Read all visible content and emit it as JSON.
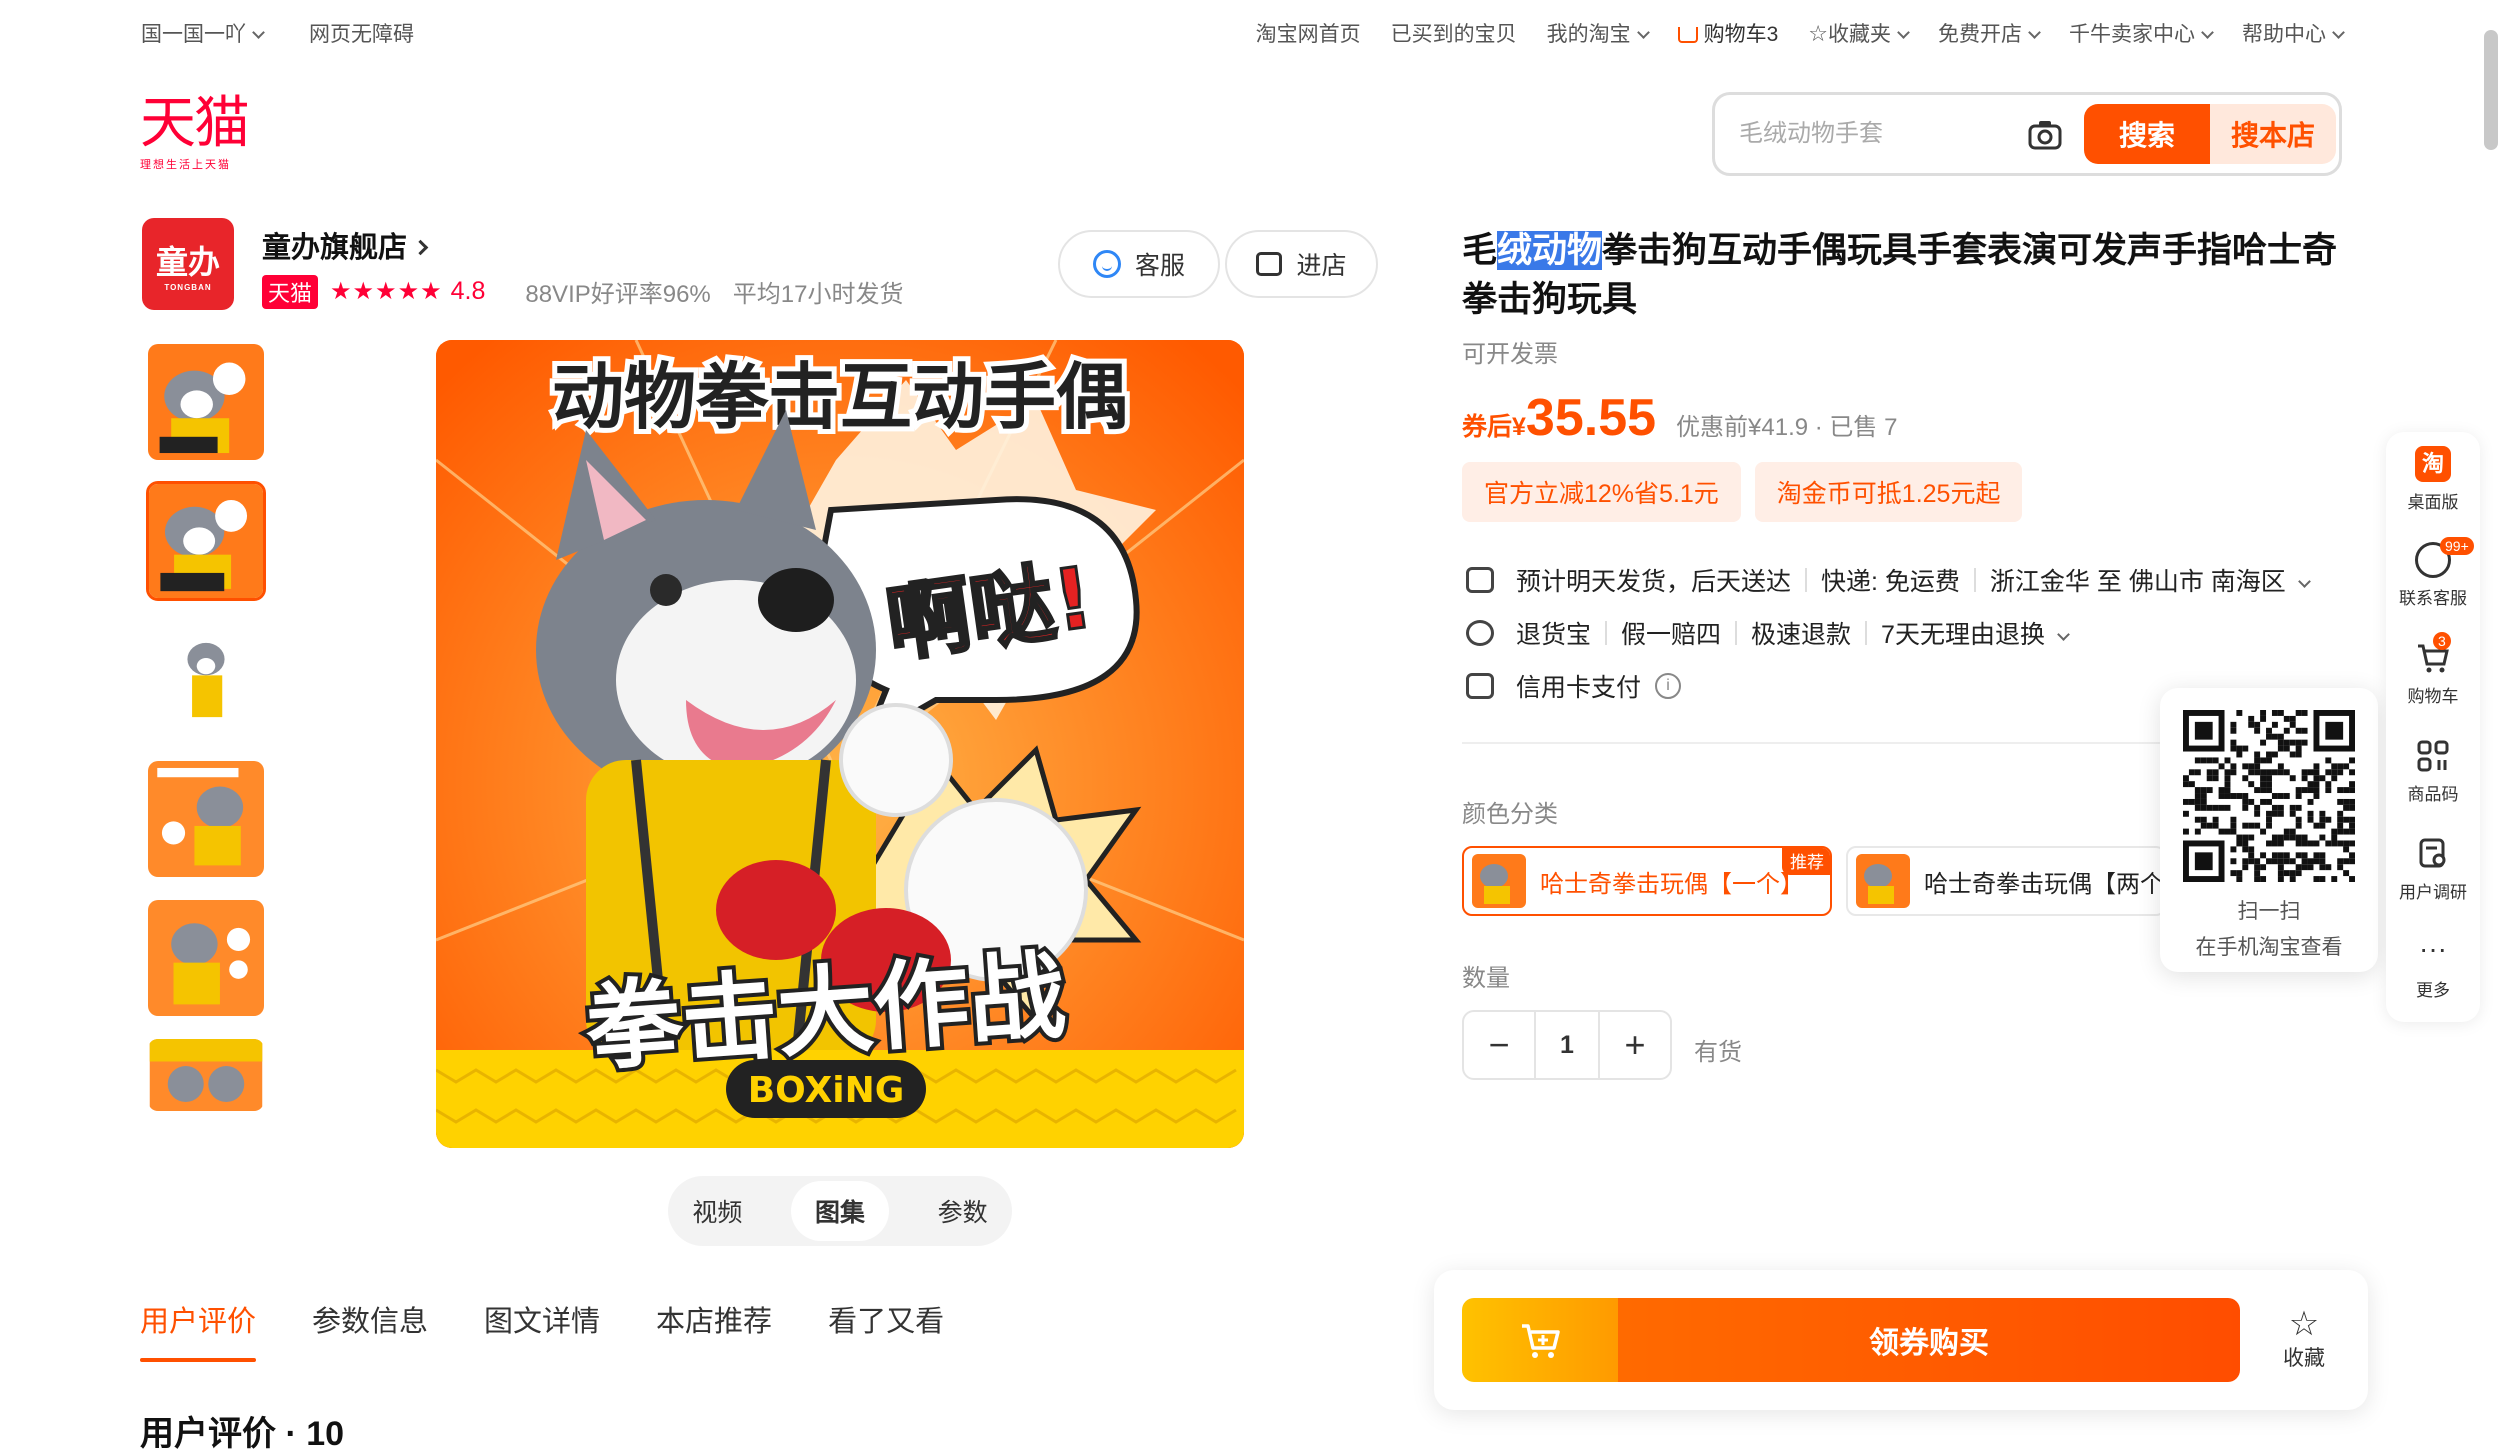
{
  "topnav": {
    "left": [
      "国一国一吖",
      "网页无障碍"
    ],
    "right": {
      "home": "淘宝网首页",
      "bought": "已买到的宝贝",
      "my": "我的淘宝",
      "cart": "购物车3",
      "fav": "收藏夹",
      "open": "免费开店",
      "seller": "千牛卖家中心",
      "help": "帮助中心"
    }
  },
  "logo": {
    "text": "天猫",
    "slogan": "理想生活上天猫"
  },
  "search": {
    "placeholder": "毛绒动物手套",
    "btn_search": "搜索",
    "btn_shop": "搜本店"
  },
  "shop": {
    "logo_text": "童办",
    "logo_sub": "TONGBAN",
    "name": "童办旗舰店",
    "tag": "天猫",
    "stars": "★★★★★",
    "rating": "4.8",
    "good_rate": "88VIP好评率96%",
    "ship_time": "平均17小时发货",
    "btn_service": "客服",
    "btn_enter": "进店"
  },
  "main_image": {
    "headline": "动物拳击互动手偶",
    "bubble": "啊哒!",
    "bottom": "拳击大作战",
    "boxing": "BOXiNG"
  },
  "image_tabs": [
    "视频",
    "图集",
    "参数"
  ],
  "bottom_tabs": [
    "用户评价",
    "参数信息",
    "图文详情",
    "本店推荐",
    "看了又看"
  ],
  "review_head": "用户评价 · 10",
  "product": {
    "title_pre": "毛",
    "title_hl": "绒动物",
    "title_post": "拳击狗互动手偶玩具手套表演可发声手指哈士奇拳击狗玩具",
    "invoice": "可开发票",
    "price_prefix": "券后¥",
    "price": "35.55",
    "price_orig": "优惠前¥41.9 · 已售 7",
    "coupons": [
      "官方立减12%省5.1元",
      "淘金币可抵1.25元起"
    ],
    "shipping": [
      "预计明天发货，后天送达",
      "快递: 免运费",
      "浙江金华 至 佛山市 南海区"
    ],
    "guarantee": [
      "退货宝",
      "假一赔四",
      "极速退款",
      "7天无理由退换"
    ],
    "payment": "信用卡支付",
    "color_label": "颜色分类",
    "skus": [
      "哈士奇拳击玩偶【一个】",
      "哈士奇拳击玩偶【两个"
    ],
    "sku_badge": "推荐",
    "qty_label": "数量",
    "qty": "1",
    "stock": "有货"
  },
  "buybar": {
    "buy": "领券购买",
    "fav": "收藏"
  },
  "qr": {
    "line1": "扫一扫",
    "line2": "在手机淘宝查看"
  },
  "sidebar": {
    "desktop": "桌面版",
    "service": "联系客服",
    "service_badge": "99+",
    "cart": "购物车",
    "cart_badge": "3",
    "qrcode": "商品码",
    "survey": "用户调研",
    "more": "更多"
  },
  "colors": {
    "accent": "#ff5000",
    "tmall": "#ff0036",
    "highlight": "#3a79e8"
  }
}
